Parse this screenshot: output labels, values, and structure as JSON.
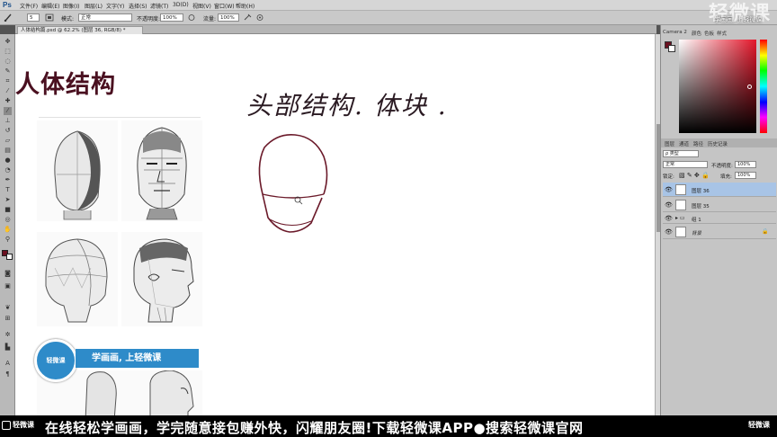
{
  "app": {
    "logo": "Ps",
    "menus": [
      "文件(F)",
      "编辑(E)",
      "图像(I)",
      "图层(L)",
      "文字(Y)",
      "选择(S)",
      "滤镜(T)",
      "3D(D)",
      "视图(V)",
      "窗口(W)",
      "帮助(H)"
    ]
  },
  "options": {
    "brush_size": "5",
    "mode_label": "模式:",
    "mode_value": "正常",
    "opacity_label": "不透明度:",
    "opacity_value": "100%",
    "flow_label": "流量:",
    "flow_value": "100%"
  },
  "document": {
    "tab_title": "人体结构篇.psd @ 62.2% (图层 36, RGB/8) *"
  },
  "canvas": {
    "title": "人体结构",
    "handwriting": "头部结构. 体块 ."
  },
  "promo": {
    "circle_text": "轻微课",
    "bar_text": "学画画, 上轻微课"
  },
  "right_panel": {
    "top_tabs": [
      "Camera 2",
      "颜色",
      "色板",
      "样式"
    ],
    "fg_color": "#6a1020",
    "layer_tabs": [
      "图层",
      "通道",
      "路径",
      "历史记录"
    ],
    "kind_label": "ρ 类型",
    "blend_mode": "正常",
    "opacity_label": "不透明度:",
    "opacity_value": "100%",
    "lock_label": "锁定:",
    "fill_label": "填充:",
    "fill_value": "100%",
    "layers": [
      {
        "name": "图层 36",
        "selected": true
      },
      {
        "name": "图层 35",
        "selected": false
      },
      {
        "name": "组 1",
        "selected": false
      },
      {
        "name": "背景",
        "selected": false
      }
    ]
  },
  "watermark": {
    "big": "轻微课",
    "small": "学画画, 上轻微课"
  },
  "banner": {
    "left_logo": "轻微课",
    "text": "在线轻松学画画，学完随意接包赚外快，闪耀朋友圈!下载轻微课APP●搜索轻微课官网",
    "right_logo": "轻微课"
  }
}
